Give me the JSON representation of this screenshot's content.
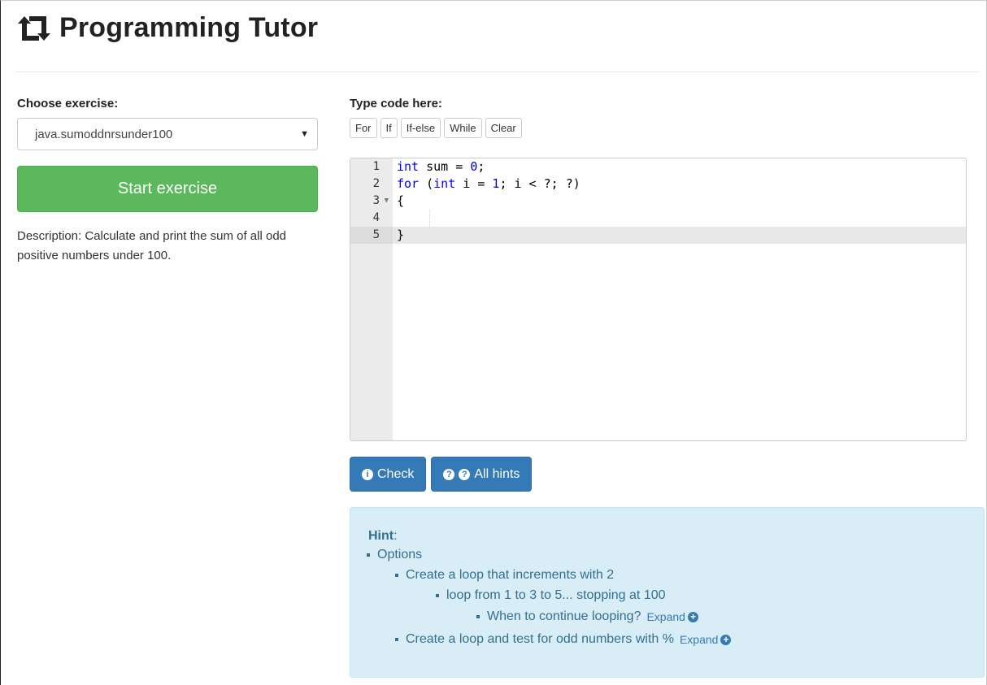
{
  "header": {
    "title": "Programming Tutor",
    "logo_icon": "retweet-icon"
  },
  "left": {
    "choose_label": "Choose exercise:",
    "selected_exercise": "java.sumoddnrsunder100",
    "start_button": "Start exercise",
    "description": "Description: Calculate and print the sum of all odd positive numbers under 100."
  },
  "right": {
    "type_label": "Type code here:",
    "snippets": [
      "For",
      "If",
      "If-else",
      "While",
      "Clear"
    ]
  },
  "editor": {
    "line_numbers": [
      "1",
      "2",
      "3",
      "4",
      "5"
    ],
    "lines": {
      "l1_kw": "int",
      "l1_rest": " sum = ",
      "l1_num": "0",
      "l1_end": ";",
      "l2_kw": "for",
      "l2_a": " (",
      "l2_kw2": "int",
      "l2_b": " i = ",
      "l2_num": "1",
      "l2_c": "; i < ?; ?)",
      "l3": "{",
      "l4": "",
      "l5": "}"
    }
  },
  "actions": {
    "check": "Check",
    "all_hints": "All hints"
  },
  "hint": {
    "label": "Hint",
    "colon": ":",
    "items": [
      "Options",
      "Create a loop that increments with 2",
      "loop from 1 to 3 to 5... stopping at 100",
      "When to continue looping?",
      "Create a loop and test for odd numbers with %"
    ],
    "expand": "Expand"
  },
  "colors": {
    "success": "#5cb85c",
    "primary": "#337ab7",
    "hint_bg": "#d9edf7",
    "hint_text": "#31708f"
  }
}
